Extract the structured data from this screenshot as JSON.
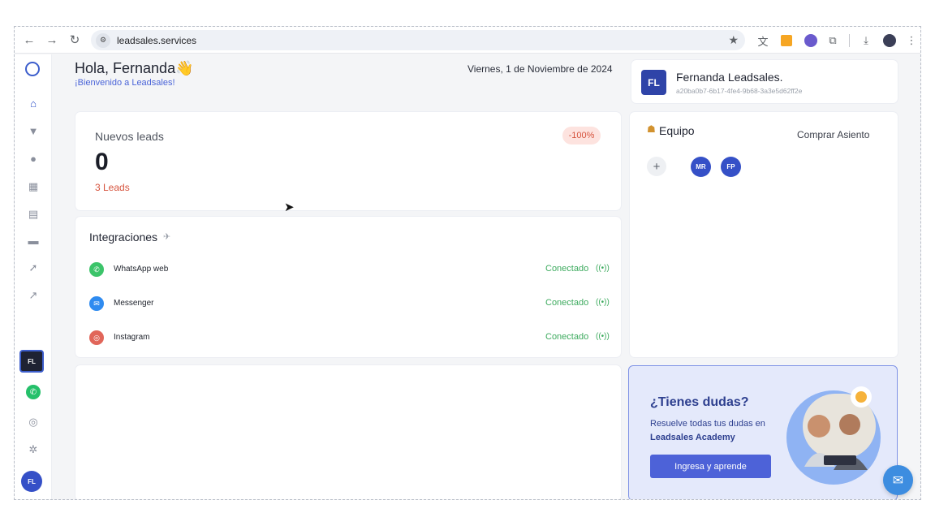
{
  "browser": {
    "url": "leadsales.services"
  },
  "header": {
    "greeting": "Hola, Fernanda👋",
    "welcome": "¡Bienvenido a Leadsales!",
    "date": "Viernes, 1 de Noviembre de 2024"
  },
  "leads": {
    "title": "Nuevos leads",
    "value": "0",
    "sub": "3 Leads",
    "badge": "-100%"
  },
  "integrations": {
    "title": "Integraciones",
    "items": [
      {
        "name": "WhatsApp web",
        "status": "Conectado",
        "icon": "whatsapp-icon"
      },
      {
        "name": "Messenger",
        "status": "Conectado",
        "icon": "messenger-icon"
      },
      {
        "name": "Instagram",
        "status": "Conectado",
        "icon": "instagram-icon"
      }
    ]
  },
  "profile": {
    "initials": "FL",
    "name": "Fernanda Leadsales.",
    "id": "a20ba0b7-6b17-4fe4-9b68-3a3e5d62ff2e"
  },
  "team": {
    "title": "Equipo",
    "buy_seat": "Comprar Asiento",
    "members": [
      "MR",
      "FP"
    ]
  },
  "academy": {
    "title": "¿Tienes dudas?",
    "text_prefix": "Resuelve todas tus dudas en",
    "text_strong": "Leadsales Academy",
    "button": "Ingresa y aprende"
  },
  "sidebar": {
    "workspace_initials": "FL",
    "user_initials": "FL"
  },
  "colors": {
    "accent": "#3550c7",
    "success": "#3eab5f",
    "danger": "#d6533d"
  }
}
